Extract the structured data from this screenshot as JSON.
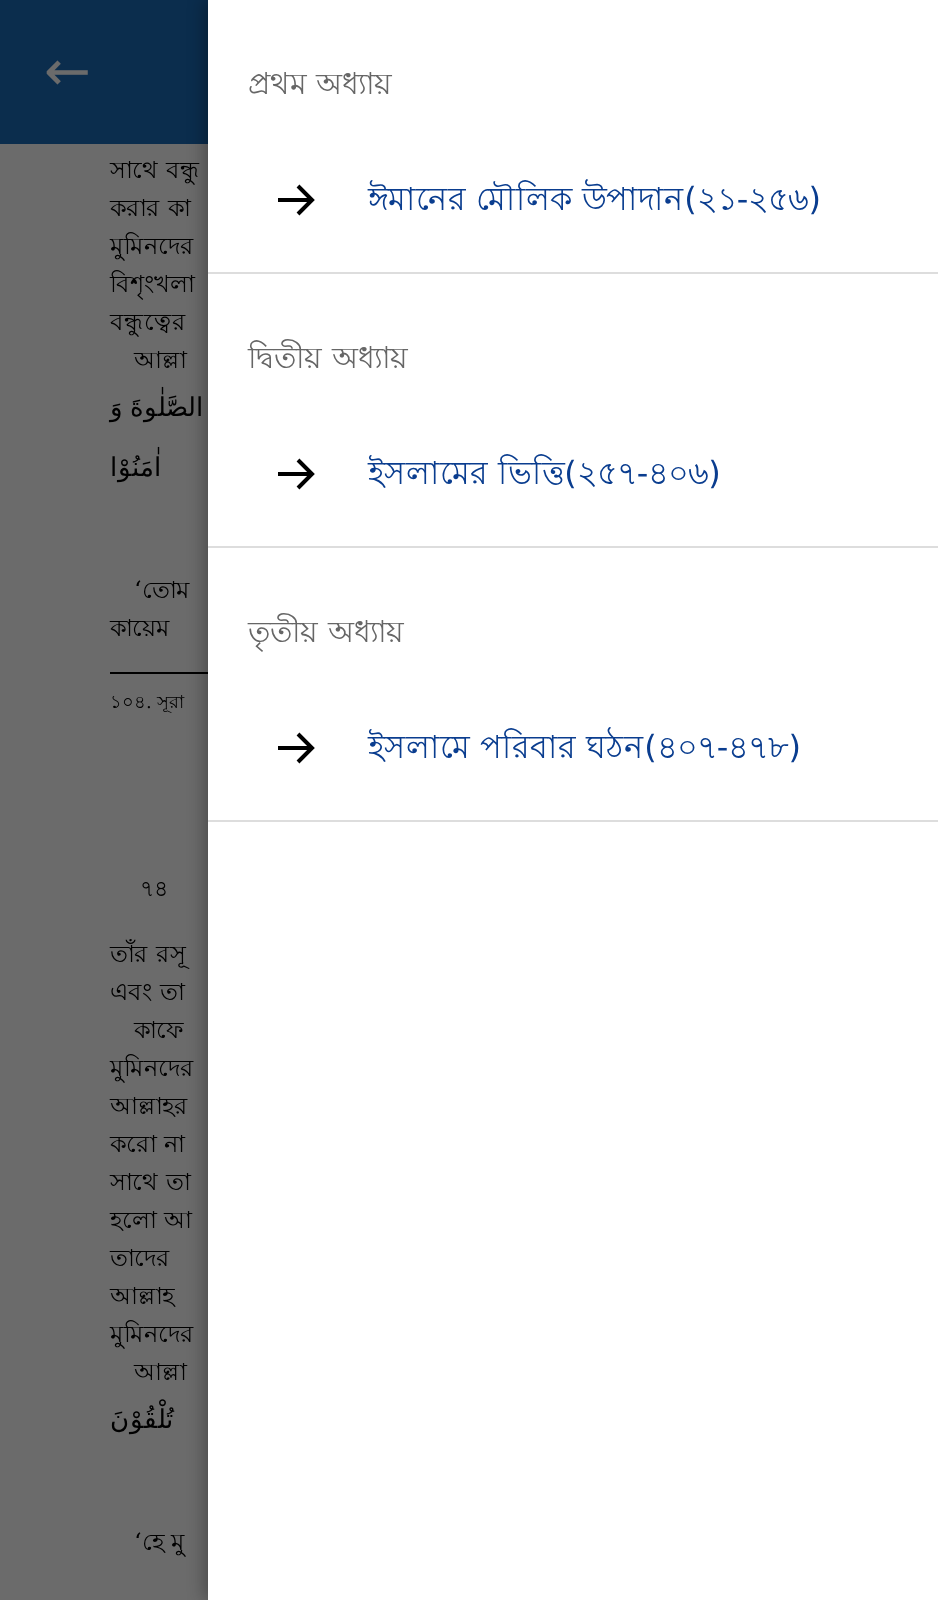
{
  "app_bar": {
    "back": "←"
  },
  "page_lines": [
    {
      "kind": "line",
      "text": "সাথে বন্ধু"
    },
    {
      "kind": "line",
      "text": "করার কা"
    },
    {
      "kind": "line",
      "text": "মুমিনদের"
    },
    {
      "kind": "line",
      "text": "বিশৃংখলা"
    },
    {
      "kind": "line",
      "text": "বন্ধুত্বের"
    },
    {
      "kind": "indent",
      "text": "আল্লা"
    },
    {
      "kind": "arabic",
      "text": "الصَّلٰوةَ وَ"
    },
    {
      "kind": "arabic",
      "text": "اٰمَنُوْا"
    },
    {
      "kind": "quote",
      "text": "‘তোম"
    },
    {
      "kind": "line",
      "text": "কায়েম"
    },
    {
      "kind": "footnote",
      "text": "১০৪.  সূরা"
    },
    {
      "kind": "page_number",
      "text": "৭৪"
    },
    {
      "kind": "line",
      "text": "তাঁর রসূ"
    },
    {
      "kind": "line",
      "text": "এবং তা"
    },
    {
      "kind": "indent",
      "text": "কাফে"
    },
    {
      "kind": "line",
      "text": "মুমিনদের"
    },
    {
      "kind": "line",
      "text": "আল্লাহর"
    },
    {
      "kind": "line",
      "text": "করো না"
    },
    {
      "kind": "line",
      "text": "সাথে তা"
    },
    {
      "kind": "line",
      "text": "হলো আ"
    },
    {
      "kind": "line",
      "text": "তাদের"
    },
    {
      "kind": "line",
      "text": "আল্লাহ"
    },
    {
      "kind": "line",
      "text": "মুমিনদের"
    },
    {
      "kind": "indent",
      "text": "আল্লা"
    },
    {
      "kind": "arabic",
      "text": "تُلْقُوْنَ"
    },
    {
      "kind": "quote",
      "text": "‘হে মু"
    }
  ],
  "drawer": {
    "sections": [
      {
        "heading": "প্রথম অধ্যায়",
        "items": [
          {
            "label": "ঈমানের মৌলিক উপাদান(২১-২৫৬)"
          }
        ]
      },
      {
        "heading": "দ্বিতীয় অধ্যায়",
        "items": [
          {
            "label": "ইসলামের ভিত্তি(২৫৭-৪০৬)"
          }
        ]
      },
      {
        "heading": "তৃতীয় অধ্যায়",
        "items": [
          {
            "label": "ইসলামে পরিবার ঘঠন(৪০৭-৪৭৮)"
          }
        ]
      }
    ]
  }
}
